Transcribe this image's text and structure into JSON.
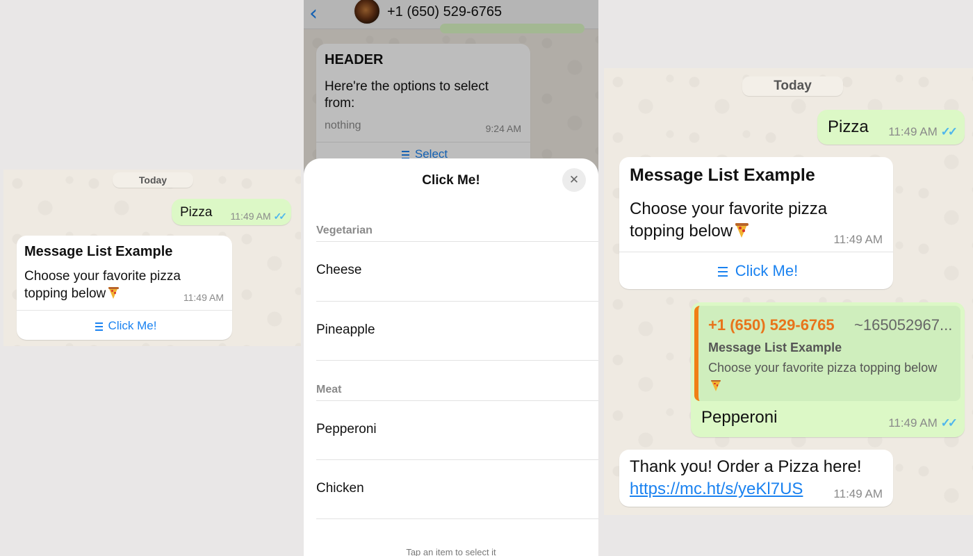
{
  "colors": {
    "accent_blue": "#1a82f0",
    "outgoing_bubble": "#dcf8c6",
    "read_ticks": "#4fb6ec",
    "quote_bar": "#f07f15"
  },
  "left": {
    "date_chip": "Today",
    "pizza_msg": {
      "text": "Pizza",
      "time": "11:49 AM",
      "status_icon": "double-check-icon"
    },
    "list_msg": {
      "header": "Message List Example",
      "body": "Choose your favorite pizza topping below",
      "emoji": "pizza-icon",
      "time": "11:49 AM",
      "button_label": "Click Me!",
      "button_icon": "list-icon"
    }
  },
  "middle": {
    "chat_header": {
      "back_icon": "chevron-left-icon",
      "contact": "+1 (650) 529-6765"
    },
    "options_msg": {
      "header": "HEADER",
      "body": "Here're the options to select from:",
      "footer": "nothing",
      "time": "9:24 AM",
      "button_label": "Select"
    },
    "sheet": {
      "title": "Click Me!",
      "close_icon": "close-icon",
      "sections": [
        {
          "title": "Vegetarian",
          "items": [
            "Cheese",
            "Pineapple"
          ]
        },
        {
          "title": "Meat",
          "items": [
            "Pepperoni",
            "Chicken"
          ]
        }
      ],
      "hint": "Tap an item to select it"
    }
  },
  "right": {
    "date_chip": "Today",
    "pizza_msg": {
      "text": "Pizza",
      "time": "11:49 AM",
      "status_icon": "double-check-icon"
    },
    "list_msg": {
      "header": "Message List Example",
      "body": "Choose your favorite pizza topping below",
      "emoji": "pizza-icon",
      "time": "11:49 AM",
      "button_label": "Click Me!"
    },
    "reply_msg": {
      "quote_sender": "+1 (650) 529-6765",
      "quote_alias": "~165052967...",
      "quote_title": "Message List Example",
      "quote_body": "Choose your favorite pizza topping below",
      "text": "Pepperoni",
      "time": "11:49 AM"
    },
    "thanks_msg": {
      "text": "Thank you! Order a Pizza here!",
      "link": "https://mc.ht/s/yeKl7US",
      "time": "11:49 AM"
    }
  }
}
